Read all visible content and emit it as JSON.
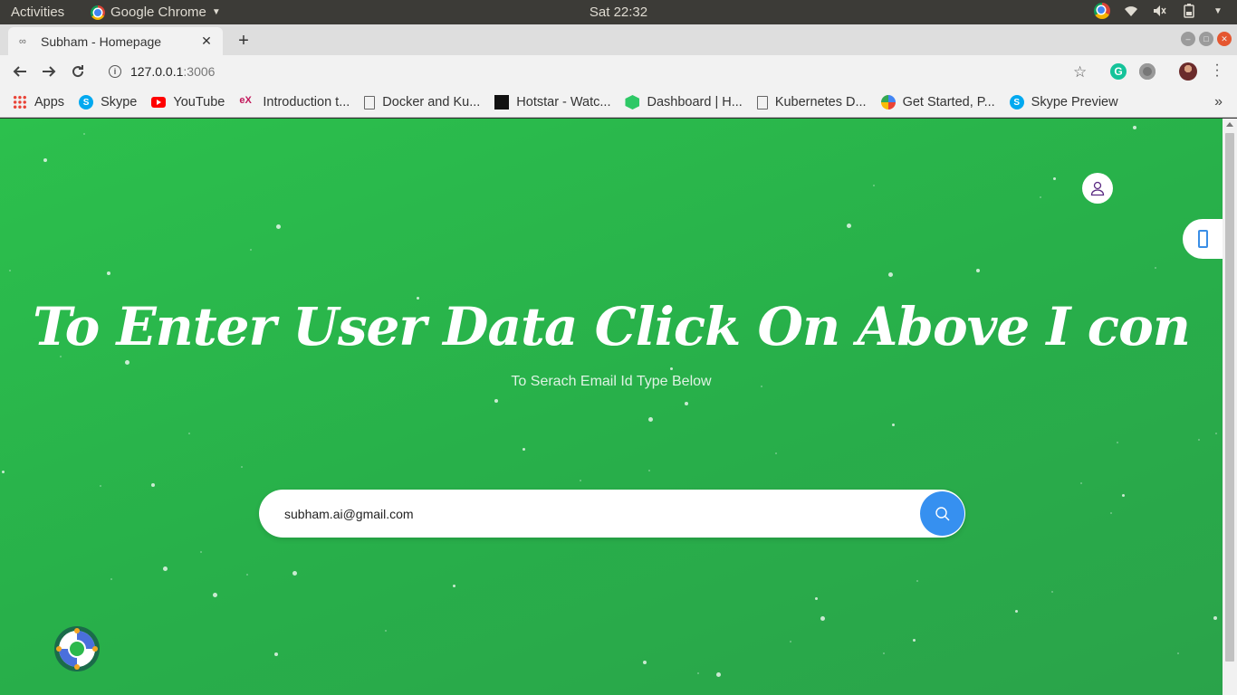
{
  "os_bar": {
    "activities": "Activities",
    "app_name": "Google Chrome",
    "clock": "Sat 22:32"
  },
  "browser": {
    "tab_title": "Subham - Homepage",
    "url_host": "127.0.0.1",
    "url_port": ":3006",
    "bookmarks": [
      {
        "label": "Apps",
        "icon": "apps-grid-icon"
      },
      {
        "label": "Skype",
        "icon": "skype-icon"
      },
      {
        "label": "YouTube",
        "icon": "youtube-icon"
      },
      {
        "label": "Introduction t...",
        "icon": "edx-icon"
      },
      {
        "label": "Docker and Ku...",
        "icon": "document-icon"
      },
      {
        "label": "Hotstar - Watc...",
        "icon": "hotstar-icon"
      },
      {
        "label": "Dashboard | H...",
        "icon": "hackerrank-icon"
      },
      {
        "label": "Kubernetes D...",
        "icon": "document-icon"
      },
      {
        "label": "Get Started, P...",
        "icon": "getstarted-icon"
      },
      {
        "label": "Skype Preview",
        "icon": "skype-icon"
      }
    ]
  },
  "page": {
    "headline": "To Enter User Data Click On Above I con",
    "subline": "To Serach Email Id Type Below",
    "search_value": "subham.ai@gmail.com",
    "accent_color": "#3690f0",
    "background_color": "#2cb84c"
  }
}
